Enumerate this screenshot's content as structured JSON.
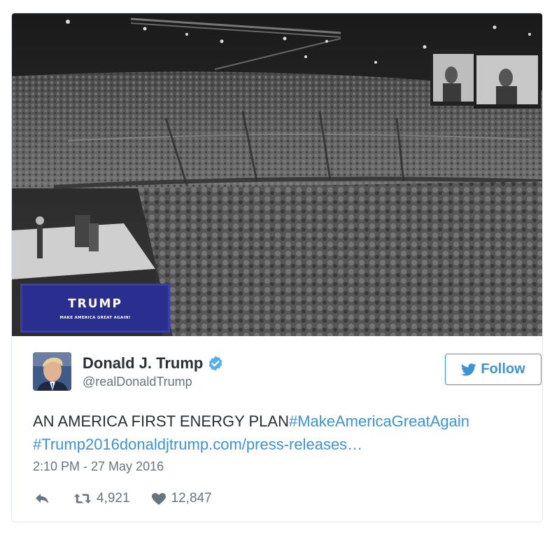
{
  "media": {
    "sign_title": "TRUMP",
    "sign_subtitle": "MAKE AMERICA GREAT AGAIN!"
  },
  "author": {
    "name": "Donald J. Trump",
    "handle": "@realDonaldTrump",
    "verified": true
  },
  "follow_label": "Follow",
  "tweet": {
    "text": "AN AMERICA FIRST ENERGY PLAN",
    "hashtag1": "#MakeAmericaGreatAgain",
    "hashtag2": "#Trump2016",
    "link": "donaldjtrump.com/press-releases…"
  },
  "timestamp": "2:10 PM - 27 May 2016",
  "stats": {
    "retweets": "4,921",
    "likes": "12,847"
  },
  "icons": [
    "verified-badge-icon",
    "twitter-bird-icon",
    "reply-icon",
    "retweet-icon",
    "heart-icon"
  ],
  "colors": {
    "accent": "#3b94d9",
    "text": "#292f33",
    "muted": "#66757f",
    "border": "#e1e8ed",
    "sign_blue": "#2a2f8f"
  }
}
